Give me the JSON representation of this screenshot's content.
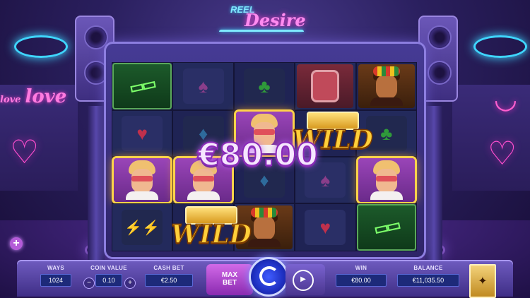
{
  "game": {
    "logo_top": "REEL",
    "logo_bottom": "Desire"
  },
  "background": {
    "neon_love_small": "love",
    "neon_love_big": "love"
  },
  "reels": {
    "win_amount": "€80.00",
    "wild_label": "WILD",
    "rows": [
      [
        "glasses",
        "spade",
        "club",
        "watch",
        "woman"
      ],
      [
        "heart",
        "diamond",
        "man-win",
        "wild",
        "club"
      ],
      [
        "man-win",
        "man-win",
        "diamond",
        "spade",
        "man-win"
      ],
      [
        "earrings",
        "wild",
        "woman",
        "heart",
        "glasses"
      ]
    ]
  },
  "controls": {
    "ways_label": "WAYS",
    "ways_value": "1024",
    "coin_value_label": "COIN VALUE",
    "coin_value": "0.10",
    "coin_minus": "−",
    "coin_plus": "+",
    "cash_bet_label": "CASH BET",
    "cash_bet_value": "€2.50",
    "max_bet_line1": "MAX",
    "max_bet_line2": "BET",
    "win_label": "WIN",
    "win_value": "€80.00",
    "balance_label": "BALANCE",
    "balance_value": "€11,035.50",
    "menu_plus": "+"
  },
  "colors": {
    "accent": "#ff8bf0",
    "neon_blue": "#3fd6ff",
    "gold": "#ffcf3a",
    "panel": "#1d2a7a"
  }
}
